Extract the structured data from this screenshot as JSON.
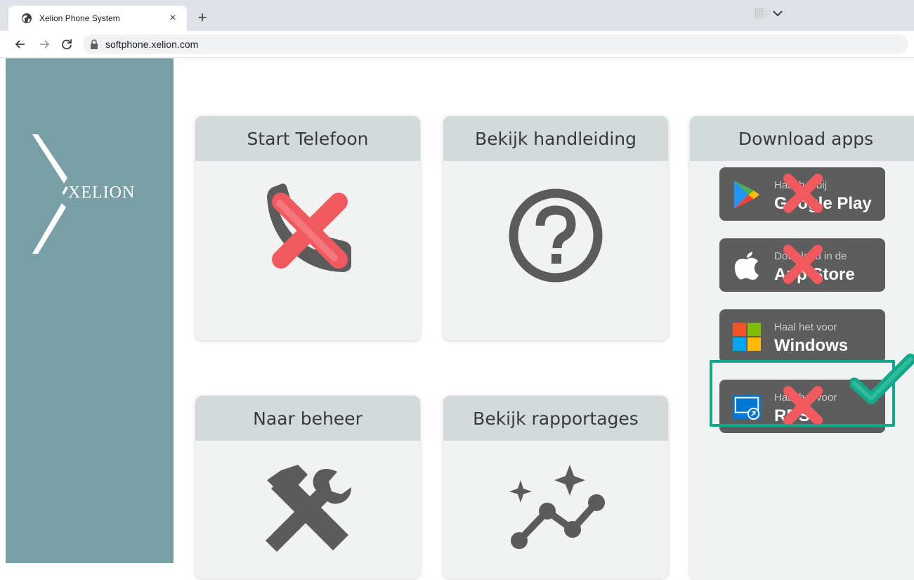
{
  "browser": {
    "tab_title": "Xelion Phone System",
    "tab_close": "×",
    "new_tab": "+",
    "url": "softphone.xelion.com"
  },
  "sidebar": {
    "logo_text": "XELION",
    "background_color": "#789ea6"
  },
  "cards": {
    "start_phone": {
      "title": "Start Telefoon",
      "icon": "phone-icon",
      "status": "crossed-out"
    },
    "manual": {
      "title": "Bekijk handleiding",
      "icon": "help-icon"
    },
    "downloads": {
      "title": "Download apps"
    },
    "admin": {
      "title": "Naar beheer",
      "icon": "tools-icon"
    },
    "reports": {
      "title": "Bekijk rapportages",
      "icon": "insights-icon"
    }
  },
  "apps": [
    {
      "small": "Haal het bij",
      "big": "Google Play",
      "icon": "google-play-icon",
      "status": "crossed-out"
    },
    {
      "small": "Download in de",
      "big": "App Store",
      "icon": "apple-icon",
      "status": "crossed-out"
    },
    {
      "small": "Haal het voor",
      "big": "Windows",
      "icon": "windows-icon",
      "status": "selected"
    },
    {
      "small": "Haal het voor",
      "big": "RDS",
      "icon": "rds-icon",
      "status": "crossed-out"
    }
  ],
  "colors": {
    "accent_check": "#13a88a",
    "cross_red": "#f05a5f",
    "card_header": "#d3dadb",
    "card_body": "#f1f2f2",
    "icon_gray": "#5b5b5b"
  }
}
